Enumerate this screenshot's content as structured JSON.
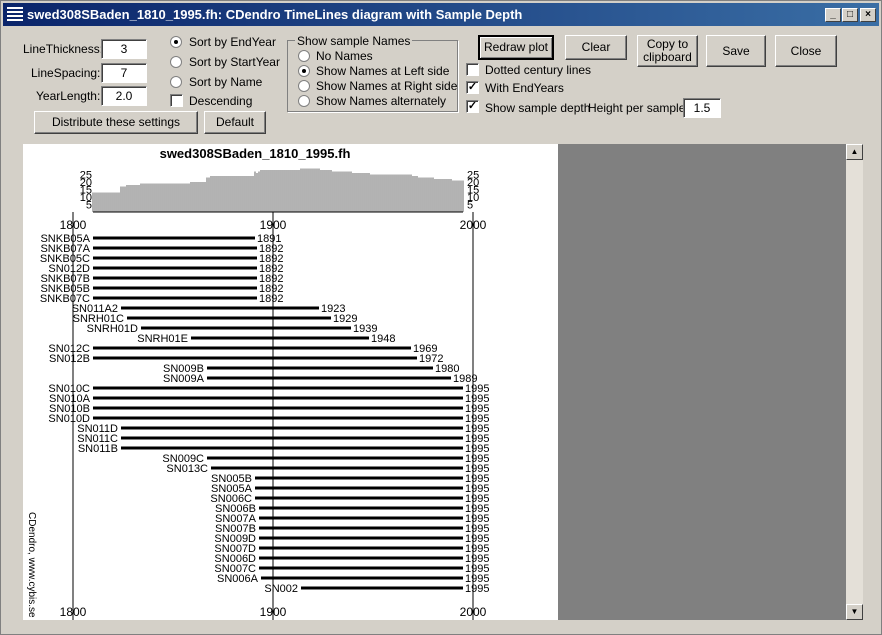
{
  "window": {
    "title": "swed308SBaden_1810_1995.fh: CDendro TimeLines diagram with Sample Depth",
    "minimize": "_",
    "maximize": "□",
    "close": "×"
  },
  "settings": {
    "line_thickness": {
      "label": "LineThickness:",
      "value": "3"
    },
    "line_spacing": {
      "label": "LineSpacing:",
      "value": "7"
    },
    "year_length": {
      "label": "YearLength:",
      "value": "2.0"
    },
    "distribute_label": "Distribute these settings",
    "default_label": "Default"
  },
  "sort": {
    "end_year": "Sort by EndYear",
    "start_year": "Sort by StartYear",
    "name": "Sort by Name",
    "descending": "Descending",
    "selected": "end_year"
  },
  "show_names": {
    "title": "Show sample Names",
    "options": [
      "No Names",
      "Show Names at Left side",
      "Show Names at Right side",
      "Show Names alternately"
    ],
    "selected": 1
  },
  "actions": {
    "redraw": "Redraw plot",
    "clear": "Clear",
    "copy": "Copy to clipboard",
    "save": "Save",
    "close": "Close"
  },
  "options": {
    "dotted_century": {
      "label": "Dotted century lines",
      "checked": false
    },
    "with_end_years": {
      "label": "With EndYears",
      "checked": true
    },
    "show_depth": {
      "label": "Show sample depth",
      "checked": true
    },
    "height_per_sample": {
      "label": "Height per sample:",
      "value": "1.5"
    }
  },
  "chart_data": {
    "type": "timeline",
    "title": "swed308SBaden_1810_1995.fh",
    "x_ticks": [
      1800,
      1900,
      2000
    ],
    "depth_ticks": [
      25,
      20,
      15,
      10,
      5
    ],
    "watermark": "CDendro, www.cybis.se",
    "series": [
      {
        "name": "SNKB05A",
        "start": 1810,
        "end": 1891
      },
      {
        "name": "SNKB07A",
        "start": 1810,
        "end": 1892
      },
      {
        "name": "SNKB05C",
        "start": 1810,
        "end": 1892
      },
      {
        "name": "SN012D",
        "start": 1810,
        "end": 1892
      },
      {
        "name": "SNKB07B",
        "start": 1810,
        "end": 1892
      },
      {
        "name": "SNKB05B",
        "start": 1810,
        "end": 1892
      },
      {
        "name": "SNKB07C",
        "start": 1810,
        "end": 1892
      },
      {
        "name": "SN011A2",
        "start": 1824,
        "end": 1923
      },
      {
        "name": "SNRH01C",
        "start": 1827,
        "end": 1929
      },
      {
        "name": "SNRH01D",
        "start": 1834,
        "end": 1939
      },
      {
        "name": "SNRH01E",
        "start": 1859,
        "end": 1948
      },
      {
        "name": "SN012C",
        "start": 1810,
        "end": 1969
      },
      {
        "name": "SN012B",
        "start": 1810,
        "end": 1972
      },
      {
        "name": "SN009B",
        "start": 1867,
        "end": 1980
      },
      {
        "name": "SN009A",
        "start": 1867,
        "end": 1989
      },
      {
        "name": "SN010C",
        "start": 1810,
        "end": 1995
      },
      {
        "name": "SN010A",
        "start": 1810,
        "end": 1995
      },
      {
        "name": "SN010B",
        "start": 1810,
        "end": 1995
      },
      {
        "name": "SN010D",
        "start": 1810,
        "end": 1995
      },
      {
        "name": "SN011D",
        "start": 1824,
        "end": 1995
      },
      {
        "name": "SN011C",
        "start": 1824,
        "end": 1995
      },
      {
        "name": "SN011B",
        "start": 1824,
        "end": 1995
      },
      {
        "name": "SN009C",
        "start": 1867,
        "end": 1995
      },
      {
        "name": "SN013C",
        "start": 1869,
        "end": 1995
      },
      {
        "name": "SN005B",
        "start": 1891,
        "end": 1995
      },
      {
        "name": "SN005A",
        "start": 1891,
        "end": 1995
      },
      {
        "name": "SN006C",
        "start": 1891,
        "end": 1995
      },
      {
        "name": "SN006B",
        "start": 1893,
        "end": 1995
      },
      {
        "name": "SN007A",
        "start": 1893,
        "end": 1995
      },
      {
        "name": "SN007B",
        "start": 1893,
        "end": 1995
      },
      {
        "name": "SN009D",
        "start": 1893,
        "end": 1995
      },
      {
        "name": "SN007D",
        "start": 1893,
        "end": 1995
      },
      {
        "name": "SN006D",
        "start": 1893,
        "end": 1995
      },
      {
        "name": "SN007C",
        "start": 1893,
        "end": 1995
      },
      {
        "name": "SN006A",
        "start": 1894,
        "end": 1995
      },
      {
        "name": "SN002",
        "start": 1914,
        "end": 1995
      }
    ]
  }
}
